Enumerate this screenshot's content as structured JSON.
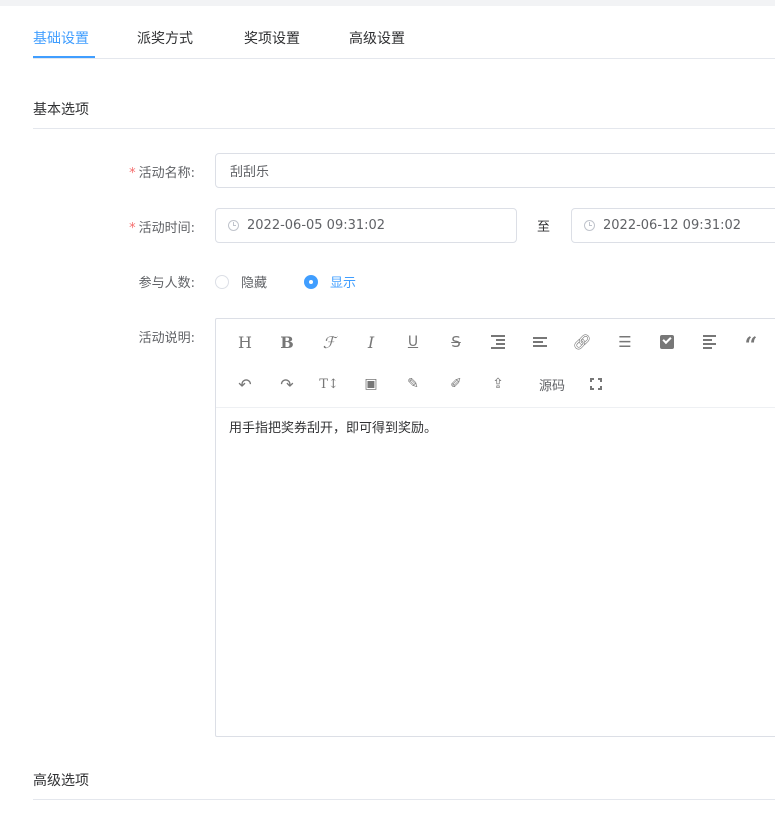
{
  "tabs": [
    {
      "label": "基础设置",
      "active": true
    },
    {
      "label": "派奖方式",
      "active": false
    },
    {
      "label": "奖项设置",
      "active": false
    },
    {
      "label": "高级设置",
      "active": false
    }
  ],
  "basic_section": {
    "title": "基本选项"
  },
  "advanced_section": {
    "title": "高级选项"
  },
  "form": {
    "name": {
      "required_mark": "*",
      "label": "活动名称:",
      "value": "刮刮乐"
    },
    "time": {
      "required_mark": "*",
      "label": "活动时间:",
      "start": "2022-06-05 09:31:02",
      "separator": "至",
      "end": "2022-06-12 09:31:02"
    },
    "participants": {
      "label": "参与人数:",
      "options": [
        {
          "label": "隐藏",
          "checked": false
        },
        {
          "label": "显示",
          "checked": true
        }
      ]
    },
    "description": {
      "label": "活动说明:",
      "toolbar_row1": [
        "H",
        "B",
        "ℱ",
        "I",
        "U",
        "S",
        "indent-icon",
        "align-icon",
        "link-icon",
        "list-icon",
        "checkbox-icon",
        "paragraph-icon",
        "quote-icon"
      ],
      "toolbar_row2": [
        "undo-icon",
        "redo-icon",
        "font-size-icon",
        "image-icon",
        "brush-icon",
        "paint-icon",
        "upload-icon",
        "源码",
        "fullscreen-icon"
      ],
      "source_label": "源码",
      "content": "用手指把奖券刮开，即可得到奖励。"
    }
  },
  "colors": {
    "accent": "#409eff",
    "required": "#f56c6c",
    "border": "#dcdfe6",
    "text": "#303133",
    "label": "#606266"
  }
}
